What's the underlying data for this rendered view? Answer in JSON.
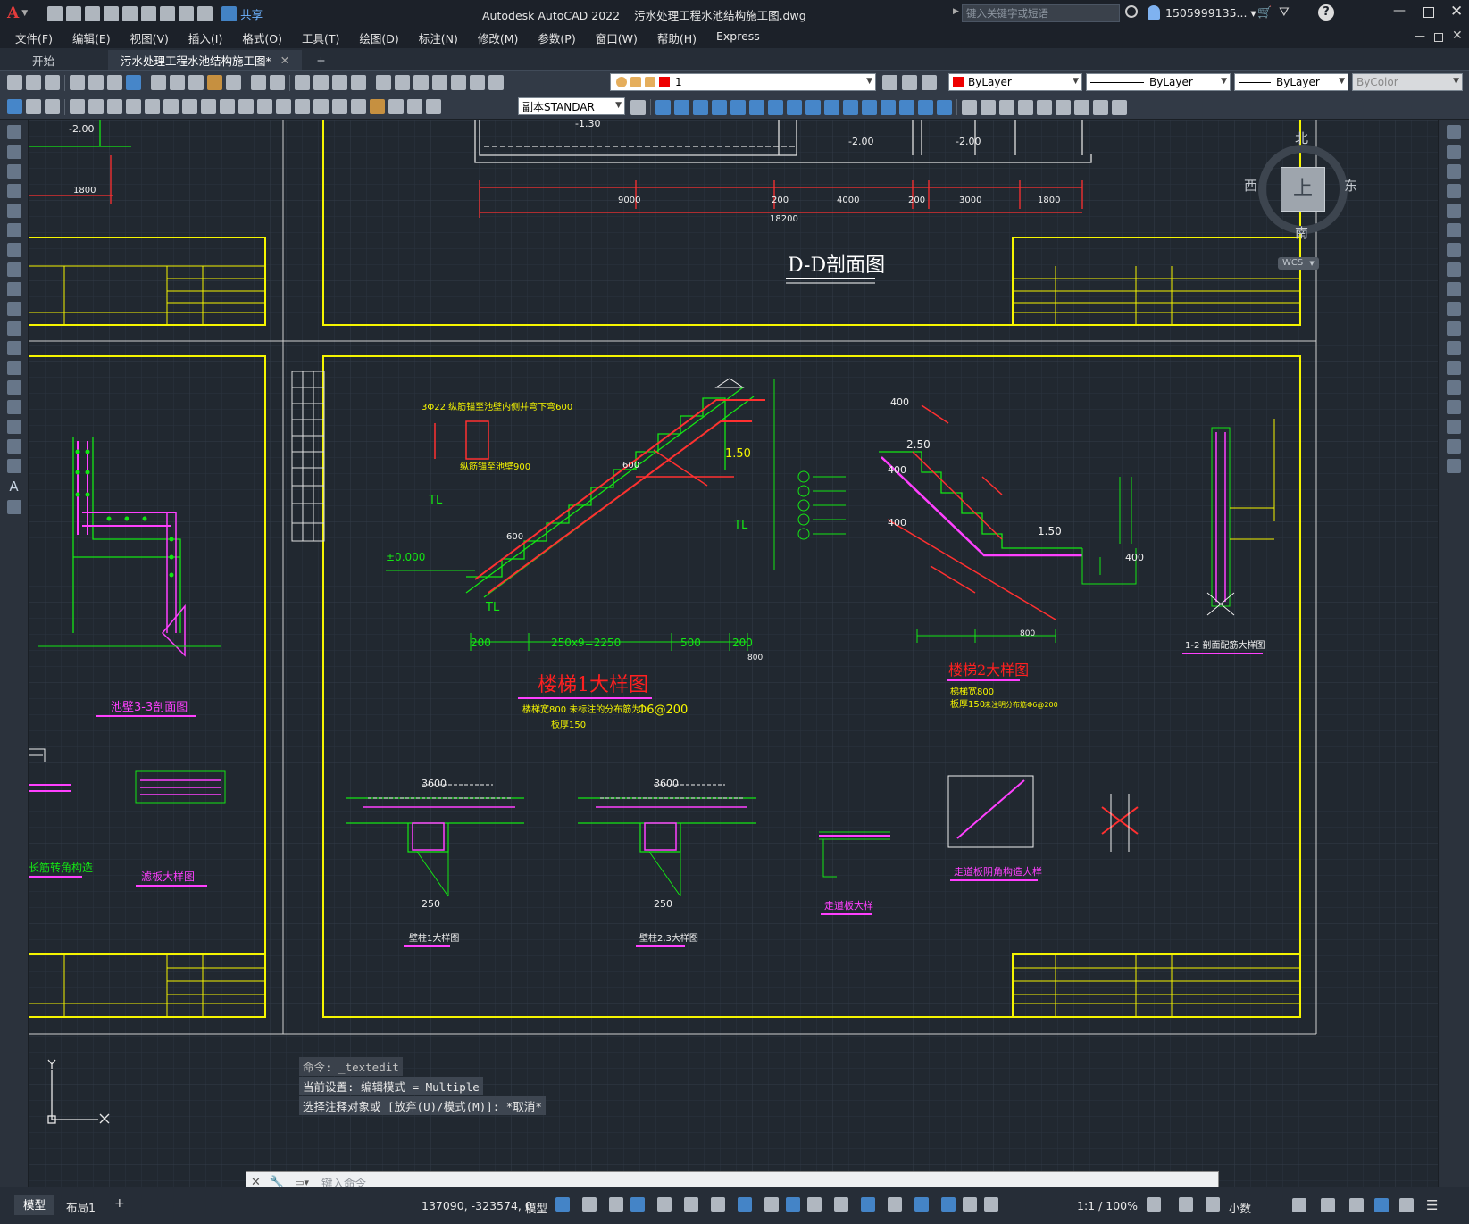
{
  "app": {
    "title": "Autodesk AutoCAD 2022",
    "filename": "污水处理工程水池结构施工图.dwg",
    "share_label": "共享",
    "search_placeholder": "键入关键字或短语",
    "user": "1505999135... ▾"
  },
  "menu": [
    "文件(F)",
    "编辑(E)",
    "视图(V)",
    "插入(I)",
    "格式(O)",
    "工具(T)",
    "绘图(D)",
    "标注(N)",
    "修改(M)",
    "参数(P)",
    "窗口(W)",
    "帮助(H)",
    "Express"
  ],
  "tabs": {
    "start": "开始",
    "doc": "污水处理工程水池结构施工图*",
    "add": "+"
  },
  "toolbar": {
    "layer_value": "1",
    "color_value": "ByLayer",
    "linetype_value": "ByLayer",
    "lineweight_value": "ByLayer",
    "plotstyle_value": "ByColor",
    "textstyle_value": "副本STANDAR"
  },
  "viewcube": {
    "north": "北",
    "south": "南",
    "east": "东",
    "west": "西",
    "top": "上",
    "wcs": "WCS"
  },
  "drawing": {
    "section_title": "D-D剖面图",
    "stair1_title": "楼梯1大样图",
    "stair1_note1": "楼梯宽800 未标注的分布筋为",
    "stair1_note2": "Φ6@200",
    "stair1_note3": "板厚150",
    "stair2_title": "楼梯2大样图",
    "stair2_note1": "梯梯宽800",
    "stair2_note2": "板厚150",
    "stair2_note3": "未注明分布筋Φ6@200",
    "wall33": "池壁3-3剖面图",
    "long_corner": "长筋转角构造",
    "slab_detail": "滤板大样图",
    "walkway": "走道板大样",
    "walkway_corner": "走道板阴角构造大样",
    "col1": "壁柱1大样图",
    "col23": "壁柱2,3大样图",
    "section12": "1-2 剖面配筋大样图",
    "dim_9000": "9000",
    "dim_200": "200",
    "dim_4000": "4000",
    "dim_3000": "3000",
    "dim_1800": "1800",
    "dim_18200": "18200",
    "lvl_200": "-2.00",
    "lvl_130": "-1.30",
    "dim_400": "400",
    "dim_600": "600",
    "dim_150": "1.50",
    "dim_250": "2.50",
    "dim_2250": "250x9=2250",
    "dim_500": "500",
    "dim_800": "800",
    "dim_pm0": "±0.000",
    "dim_3600": "3600",
    "dim_250b": "250",
    "rebar_top": "3Φ22 纵筋锚至池壁内侧并弯下弯600",
    "rebar_bot": "纵筋锚至池壁900",
    "tl": "TL"
  },
  "command": {
    "line1": "命令: _textedit",
    "line2": "当前设置: 编辑模式 = Multiple",
    "line3": "选择注释对象或 [放弃(U)/模式(M)]: *取消*",
    "input_placeholder": "键入命令"
  },
  "status": {
    "model_tab": "模型",
    "layout_tab": "布局1",
    "add": "+",
    "coords": "137090, -323574, 0",
    "mode": "模型",
    "scale": "1:1 / 100%",
    "units": "小数"
  },
  "colors": {
    "yellow": "#f5f500",
    "green": "#14e614",
    "red": "#ff2020",
    "magenta": "#ff40ff",
    "white": "#f0f0f0",
    "grid": "#2c343f"
  }
}
